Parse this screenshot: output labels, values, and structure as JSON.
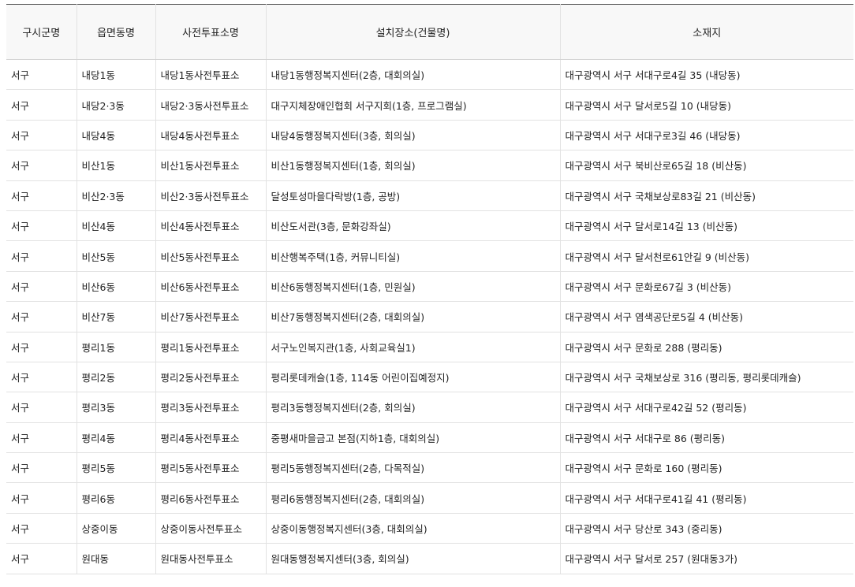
{
  "table": {
    "headers": [
      "구시군명",
      "읍면동명",
      "사전투표소명",
      "설치장소(건물명)",
      "소재지"
    ],
    "rows": [
      [
        "서구",
        "내당1동",
        "내당1동사전투표소",
        "내당1동행정복지센터(2층, 대회의실)",
        "대구광역시 서구 서대구로4길 35 (내당동)"
      ],
      [
        "서구",
        "내당2·3동",
        "내당2·3동사전투표소",
        "대구지체장애인협회 서구지회(1층, 프로그램실)",
        "대구광역시 서구 달서로5길 10 (내당동)"
      ],
      [
        "서구",
        "내당4동",
        "내당4동사전투표소",
        "내당4동행정복지센터(3층, 회의실)",
        "대구광역시 서구 서대구로3길 46 (내당동)"
      ],
      [
        "서구",
        "비산1동",
        "비산1동사전투표소",
        "비산1동행정복지센터(1층, 회의실)",
        "대구광역시 서구 북비산로65길 18 (비산동)"
      ],
      [
        "서구",
        "비산2·3동",
        "비산2·3동사전투표소",
        "달성토성마을다락방(1층, 공방)",
        "대구광역시 서구 국채보상로83길 21 (비산동)"
      ],
      [
        "서구",
        "비산4동",
        "비산4동사전투표소",
        "비산도서관(3층, 문화강좌실)",
        "대구광역시 서구 달서로14길 13 (비산동)"
      ],
      [
        "서구",
        "비산5동",
        "비산5동사전투표소",
        "비산행복주택(1층, 커뮤니티실)",
        "대구광역시 서구 달서천로61안길 9 (비산동)"
      ],
      [
        "서구",
        "비산6동",
        "비산6동사전투표소",
        "비산6동행정복지센터(1층, 민원실)",
        "대구광역시 서구 문화로67길 3 (비산동)"
      ],
      [
        "서구",
        "비산7동",
        "비산7동사전투표소",
        "비산7동행정복지센터(2층, 대회의실)",
        "대구광역시 서구 염색공단로5길 4 (비산동)"
      ],
      [
        "서구",
        "평리1동",
        "평리1동사전투표소",
        "서구노인복지관(1층, 사회교육실1)",
        "대구광역시 서구 문화로 288 (평리동)"
      ],
      [
        "서구",
        "평리2동",
        "평리2동사전투표소",
        "평리롯데캐슬(1층, 114동 어린이집예정지)",
        "대구광역시 서구 국채보상로 316 (평리동, 평리롯데캐슬)"
      ],
      [
        "서구",
        "평리3동",
        "평리3동사전투표소",
        "평리3동행정복지센터(2층, 회의실)",
        "대구광역시 서구 서대구로42길 52 (평리동)"
      ],
      [
        "서구",
        "평리4동",
        "평리4동사전투표소",
        "중평새마을금고 본점(지하1층, 대회의실)",
        "대구광역시 서구 서대구로 86 (평리동)"
      ],
      [
        "서구",
        "평리5동",
        "평리5동사전투표소",
        "평리5동행정복지센터(2층, 다목적실)",
        "대구광역시 서구 문화로 160 (평리동)"
      ],
      [
        "서구",
        "평리6동",
        "평리6동사전투표소",
        "평리6동행정복지센터(2층, 대회의실)",
        "대구광역시 서구 서대구로41길 41 (평리동)"
      ],
      [
        "서구",
        "상중이동",
        "상중이동사전투표소",
        "상중이동행정복지센터(3층, 대회의실)",
        "대구광역시 서구 당산로 343 (중리동)"
      ],
      [
        "서구",
        "원대동",
        "원대동사전투표소",
        "원대동행정복지센터(3층, 회의실)",
        "대구광역시 서구 달서로 257 (원대동3가)"
      ]
    ]
  }
}
